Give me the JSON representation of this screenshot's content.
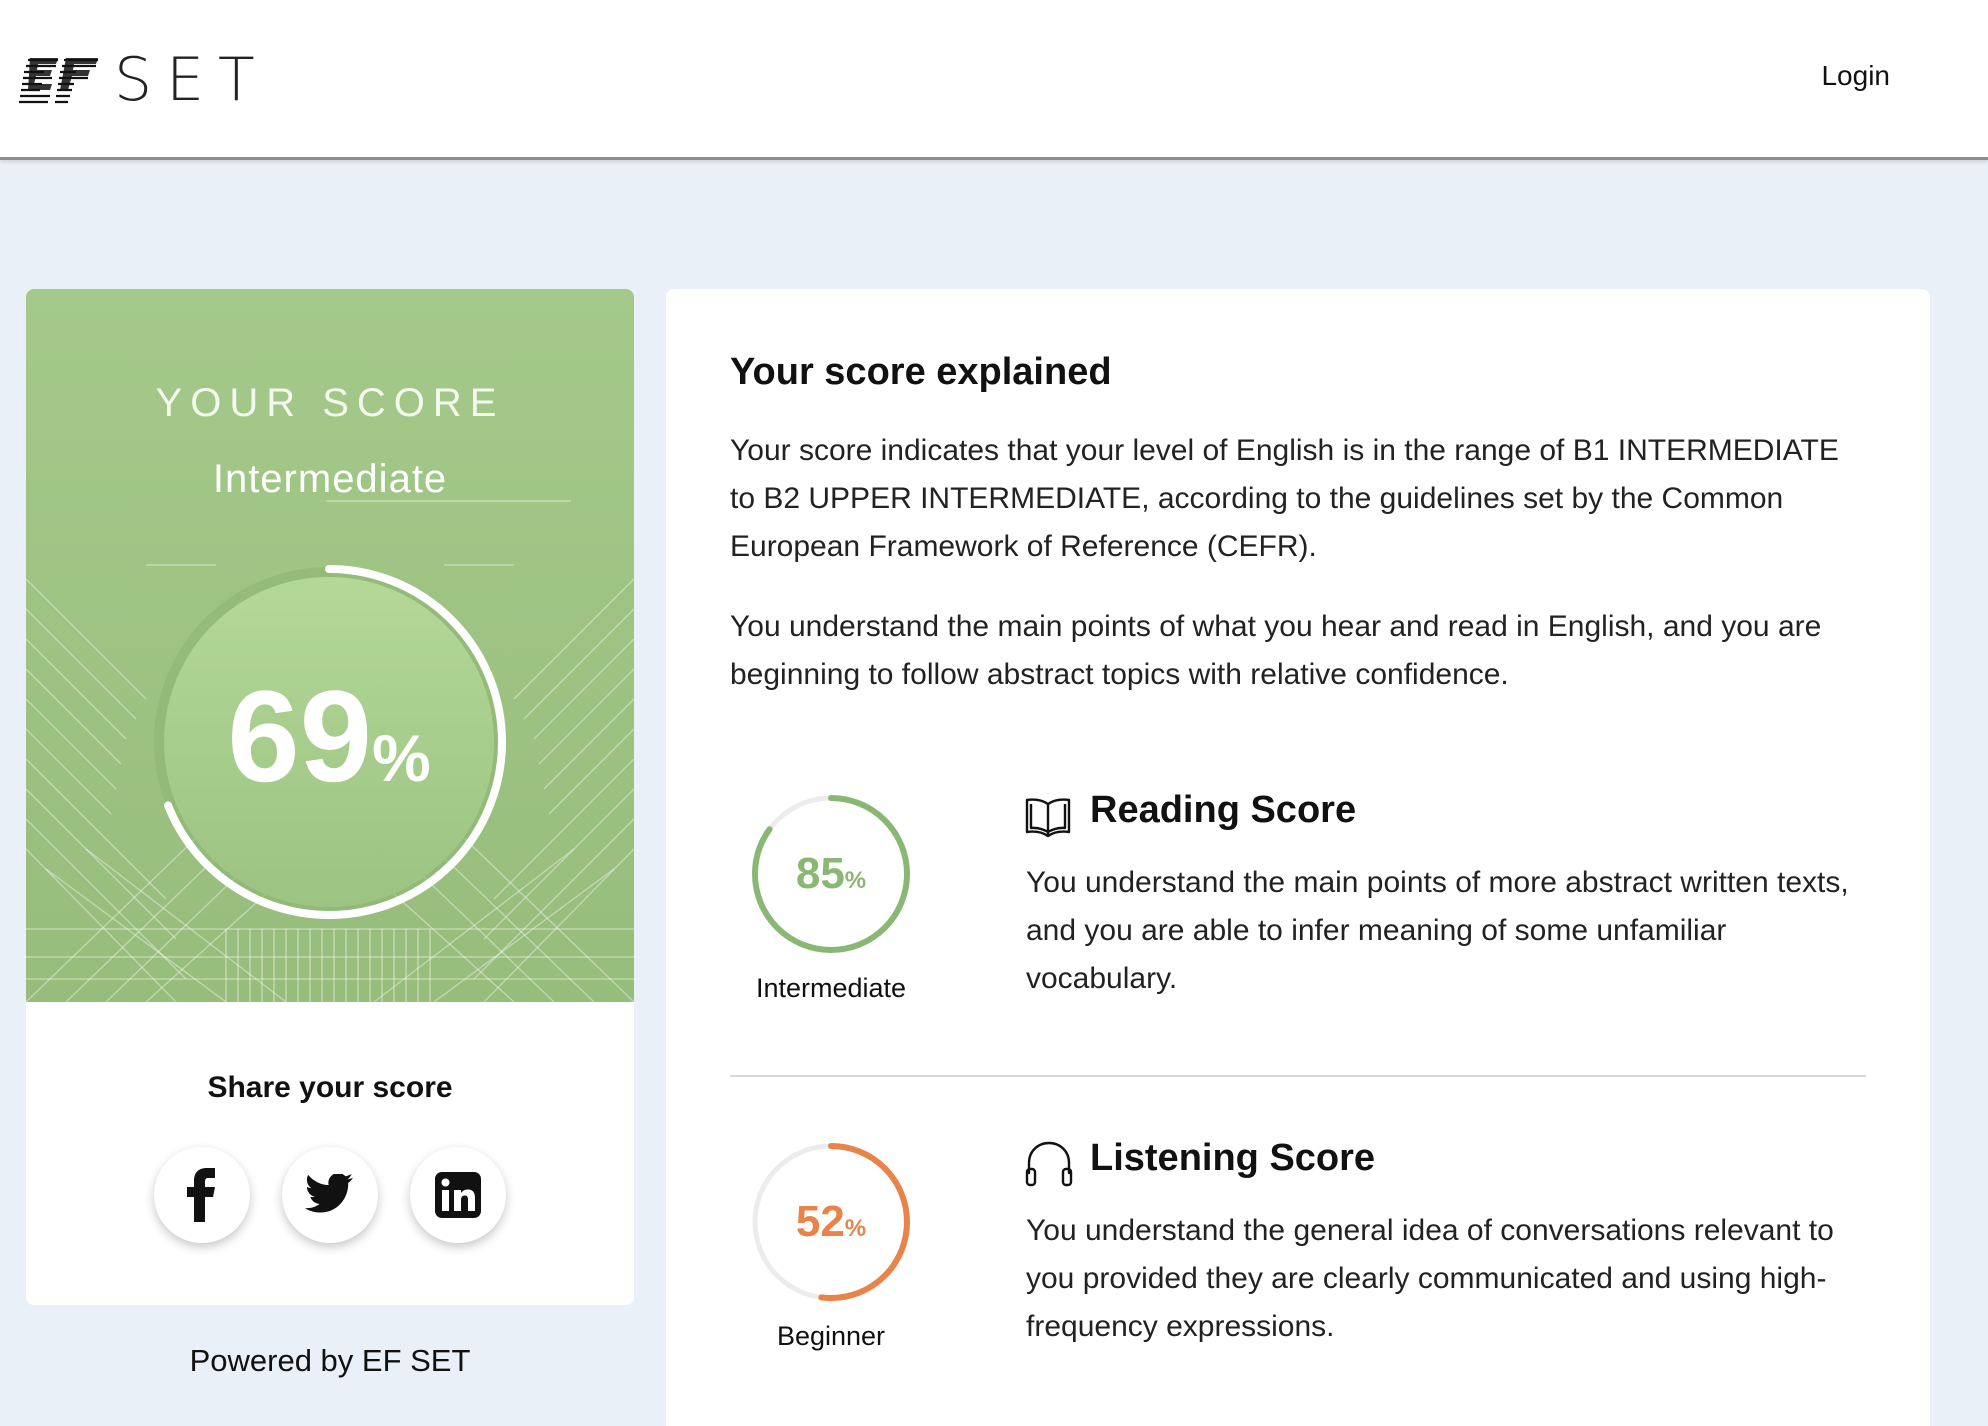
{
  "header": {
    "logo_text": "SET",
    "logo_icon": "ef-logo-icon",
    "login_label": "Login"
  },
  "score_card": {
    "heading": "YOUR SCORE",
    "level": "Intermediate",
    "value": "69",
    "percent_sign": "%",
    "progress": 0.69,
    "share_title": "Share your score",
    "social": [
      {
        "icon": "facebook-icon"
      },
      {
        "icon": "twitter-icon"
      },
      {
        "icon": "linkedin-icon"
      }
    ],
    "colors": {
      "ring": "#ffffff",
      "hero": "#a4c98a"
    }
  },
  "powered_by": "Powered by EF SET",
  "explanation": {
    "title": "Your score explained",
    "paragraph1": "Your score indicates that your level of English is in the range of B1 INTERMEDIATE to B2 UPPER INTERMEDIATE, according to the guidelines set by the Common European Framework of Reference (CEFR).",
    "paragraph2": "You understand the main points of what you hear and read in English, and you are beginning to follow abstract topics with relative confidence."
  },
  "reading": {
    "title": "Reading Score",
    "icon": "book-icon",
    "value": "85",
    "percent_sign": "%",
    "progress": 0.85,
    "level": "Intermediate",
    "color": "#8ab874",
    "text": "You understand the main points of more abstract written texts, and you are able to infer meaning of some unfamiliar vocabulary."
  },
  "listening": {
    "title": "Listening Score",
    "icon": "headphones-icon",
    "value": "52",
    "percent_sign": "%",
    "progress": 0.52,
    "level": "Beginner",
    "color": "#e8834a",
    "text": "You understand the general idea of conversations relevant to you provided they are clearly communicated and using high-frequency expressions."
  }
}
